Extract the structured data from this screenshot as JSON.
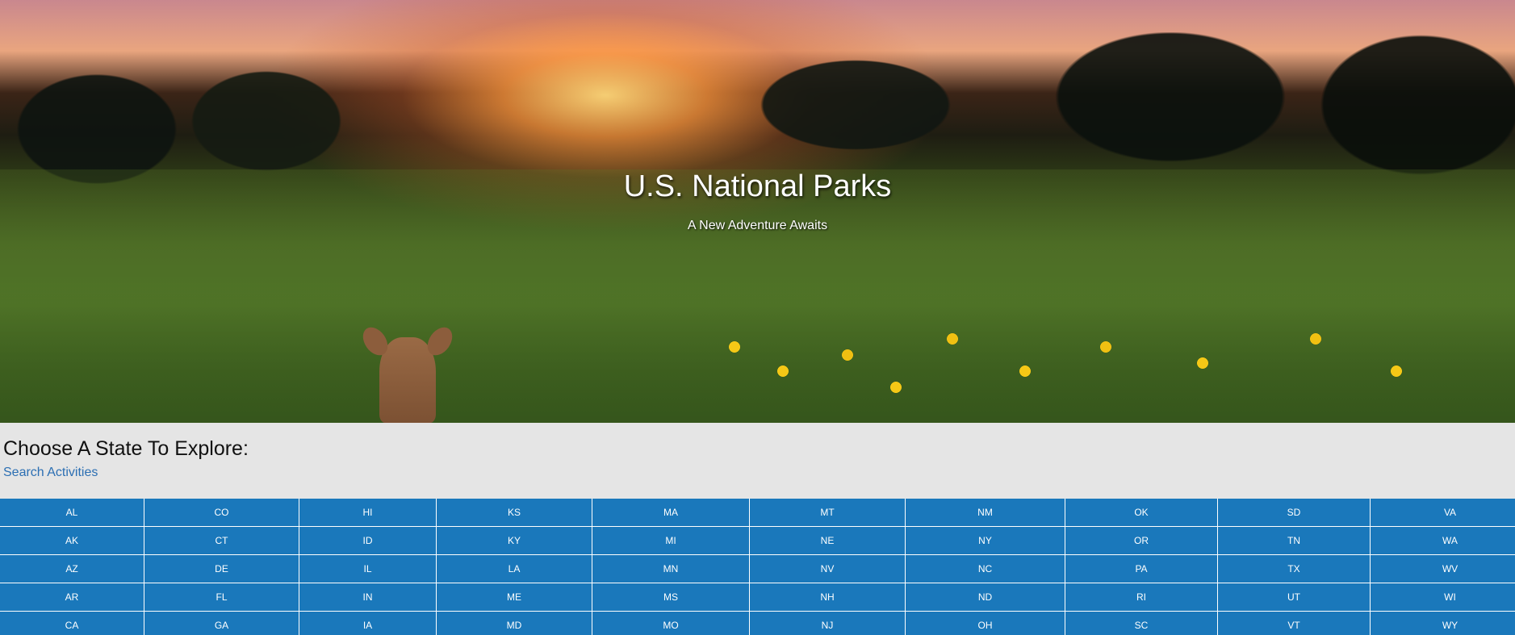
{
  "hero": {
    "title": "U.S. National Parks",
    "subtitle": "A New Adventure Awaits"
  },
  "chooser": {
    "heading": "Choose A State To Explore:",
    "search_link": "Search Activities",
    "link_color": "#2c6fb3"
  },
  "states": {
    "button_color": "#1a78bb",
    "rows": [
      [
        "AL",
        "CO",
        "HI",
        "KS",
        "MA",
        "MT",
        "NM",
        "OK",
        "SD",
        "VA"
      ],
      [
        "AK",
        "CT",
        "ID",
        "KY",
        "MI",
        "NE",
        "NY",
        "OR",
        "TN",
        "WA"
      ],
      [
        "AZ",
        "DE",
        "IL",
        "LA",
        "MN",
        "NV",
        "NC",
        "PA",
        "TX",
        "WV"
      ],
      [
        "AR",
        "FL",
        "IN",
        "ME",
        "MS",
        "NH",
        "ND",
        "RI",
        "UT",
        "WI"
      ],
      [
        "CA",
        "GA",
        "IA",
        "MD",
        "MO",
        "NJ",
        "OH",
        "SC",
        "VT",
        "WY"
      ]
    ]
  }
}
